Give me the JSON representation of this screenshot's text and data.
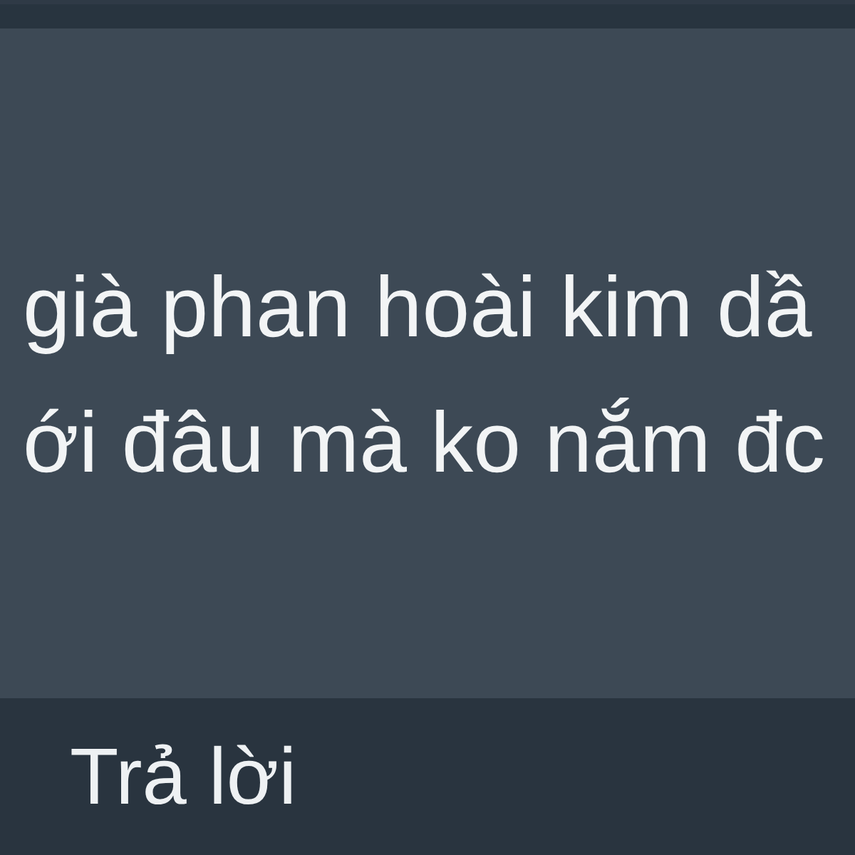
{
  "comment": {
    "lines": [
      "già phan hoài kim dầ",
      "ới đâu mà ko nắm đc"
    ]
  },
  "footer": {
    "reply": "Trả lời"
  }
}
